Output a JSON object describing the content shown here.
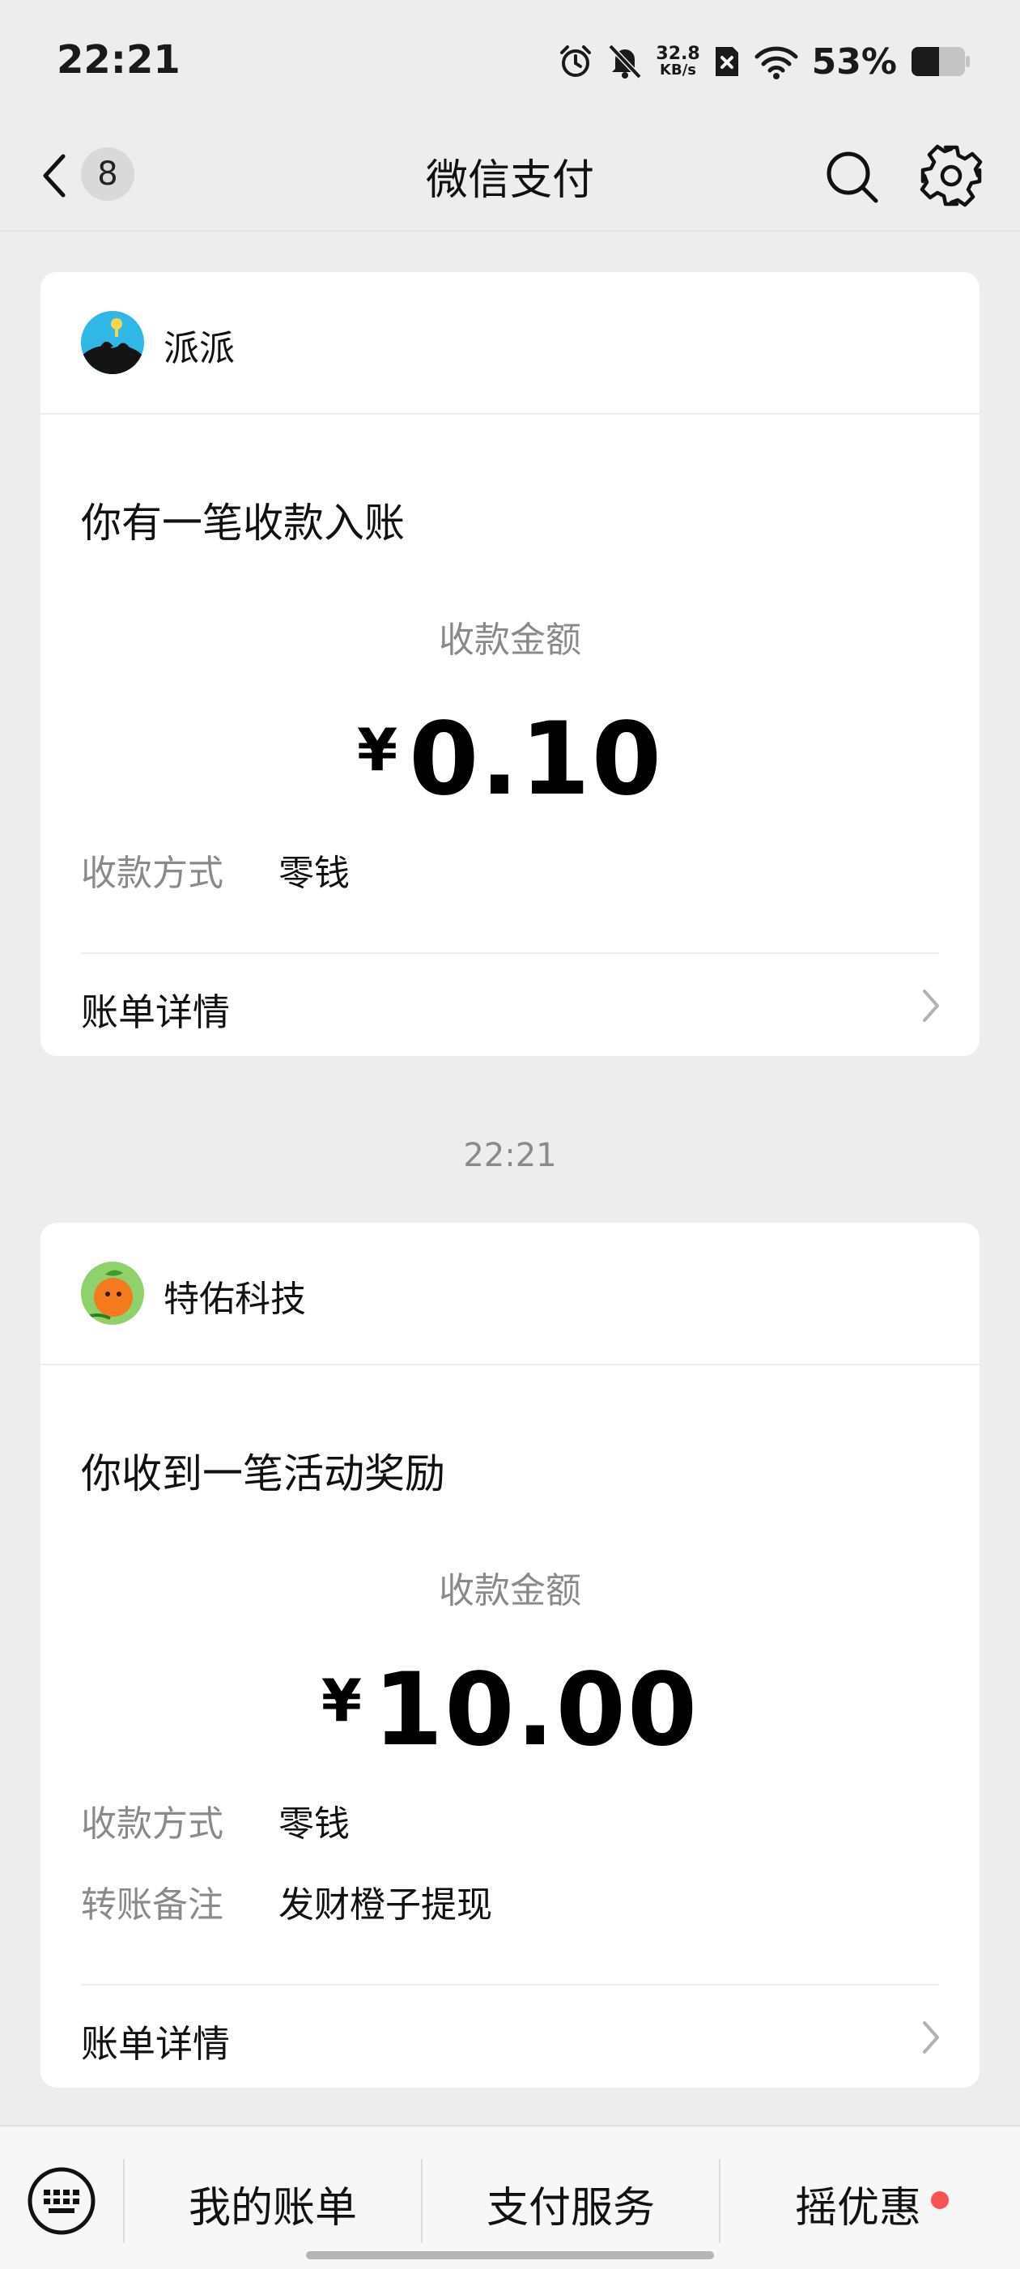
{
  "status_bar": {
    "time": "22:21",
    "net_speed_value": "32.8",
    "net_speed_unit": "KB/s",
    "battery_percent": "53%",
    "icons": [
      "alarm-icon",
      "mute-icon",
      "netspeed",
      "sim-x-icon",
      "wifi-icon",
      "battery-icon"
    ]
  },
  "nav": {
    "unread_count": "8",
    "title": "微信支付",
    "icons": [
      "back-chevron-icon",
      "search-icon",
      "gear-icon"
    ]
  },
  "cards": [
    {
      "merchant": "派派",
      "title": "你有一笔收款入账",
      "amount_label": "收款金额",
      "currency_symbol": "¥",
      "amount": "0.10",
      "rows": [
        {
          "label": "收款方式",
          "value": "零钱"
        }
      ],
      "detail_label": "账单详情"
    },
    {
      "merchant": "特佑科技",
      "title": "你收到一笔活动奖励",
      "amount_label": "收款金额",
      "currency_symbol": "¥",
      "amount": "10.00",
      "rows": [
        {
          "label": "收款方式",
          "value": "零钱"
        },
        {
          "label": "转账备注",
          "value": "发财橙子提现"
        }
      ],
      "detail_label": "账单详情"
    }
  ],
  "timestamp": "22:21",
  "bottom_bar": {
    "tabs": [
      "我的账单",
      "支付服务",
      "摇优惠"
    ],
    "keyboard_icon": "keyboard-icon",
    "colors": {
      "red_dot": "#fa5151"
    }
  }
}
